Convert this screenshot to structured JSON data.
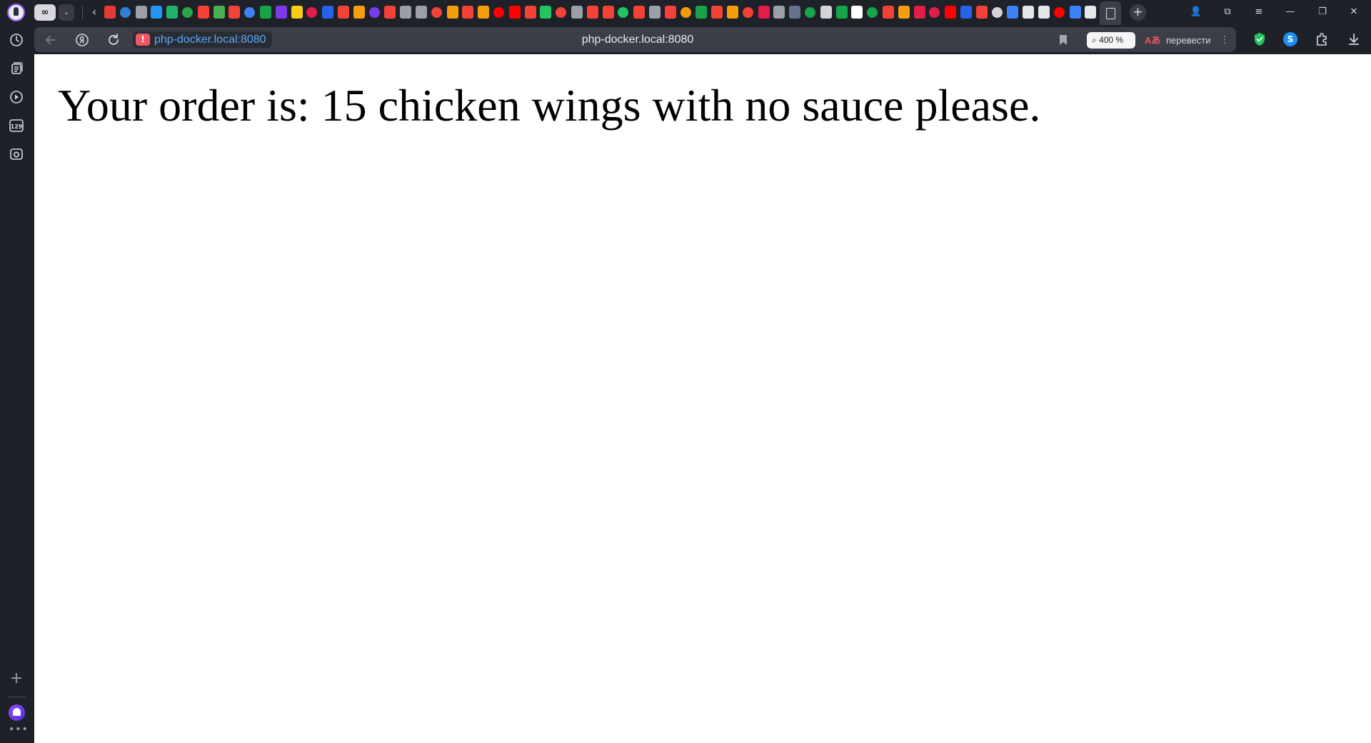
{
  "browser": {
    "tabbar": {
      "profile_icon": "profile-avatar-icon",
      "incognito_label": "∞",
      "dropdown_glyph": "⌄",
      "scroll_left_glyph": "‹",
      "new_tab_glyph": "+",
      "pinned_tab_colors": [
        "#e53935",
        "#2f7fd6",
        "#9aa0a6",
        "#2196f3",
        "#1fb26b",
        "#2aa64a",
        "#f44336",
        "#4caf50",
        "#f44336",
        "#3b82f6",
        "#16a34a",
        "#7c3aed",
        "#facc15",
        "#e11d48",
        "#2563eb",
        "#f44336",
        "#f59e0b",
        "#7c3aed",
        "#f44336",
        "#9aa0a6",
        "#9aa0a6",
        "#f44336",
        "#f59e0b",
        "#f44336",
        "#f59e0b",
        "#ff0000",
        "#ff0000",
        "#f44336",
        "#22c55e",
        "#f44336",
        "#9aa0a6",
        "#f44336",
        "#f44336",
        "#22c55e",
        "#f44336",
        "#9aa0a6",
        "#f44336",
        "#f59e0b",
        "#16a34a",
        "#f44336",
        "#f59e0b",
        "#f44336",
        "#e11d48",
        "#9aa0a6",
        "#64748b",
        "#16a34a",
        "#d4d4d8",
        "#16a34a",
        "#ffffff",
        "#16a34a",
        "#f44336",
        "#f59e0b",
        "#e11d48",
        "#e11d48",
        "#ff0000",
        "#2563eb",
        "#f44336",
        "#d4d4d8",
        "#3b82f6",
        "#e5e7eb",
        "#e5e7eb",
        "#ff0000",
        "#3b82f6",
        "#e5e7eb"
      ]
    },
    "window_controls": {
      "profile_glyph": "👤",
      "collections_glyph": "⧉",
      "menu_glyph": "≡",
      "minimize_glyph": "—",
      "restore_glyph": "❐",
      "close_glyph": "✕"
    },
    "sidebar": {
      "items": [
        {
          "name": "history-icon"
        },
        {
          "name": "collections-icon"
        },
        {
          "name": "video-icon"
        },
        {
          "name": "counter-icon",
          "label": "129"
        },
        {
          "name": "screenshot-icon"
        }
      ],
      "add_glyph": "+",
      "more_glyph": "•••"
    },
    "omnibox": {
      "url": "php-docker.local:8080",
      "page_title": "php-docker.local:8080",
      "insecure_glyph": "!",
      "zoom_label": "400 %",
      "translate_label": "перевести",
      "translate_glyph": "Aあ",
      "menu_glyph": "⋮"
    },
    "extensions": {
      "swap_label": "S"
    }
  },
  "page": {
    "order_text": "Your order is: 15 chicken wings with no sauce please."
  },
  "colors": {
    "chrome_bg": "#1f2128",
    "omnibox_bg": "#3b3d47",
    "url_color": "#5aa9f5",
    "insecure_red": "#ef5663",
    "alice_purple": "#7b3ff2"
  }
}
